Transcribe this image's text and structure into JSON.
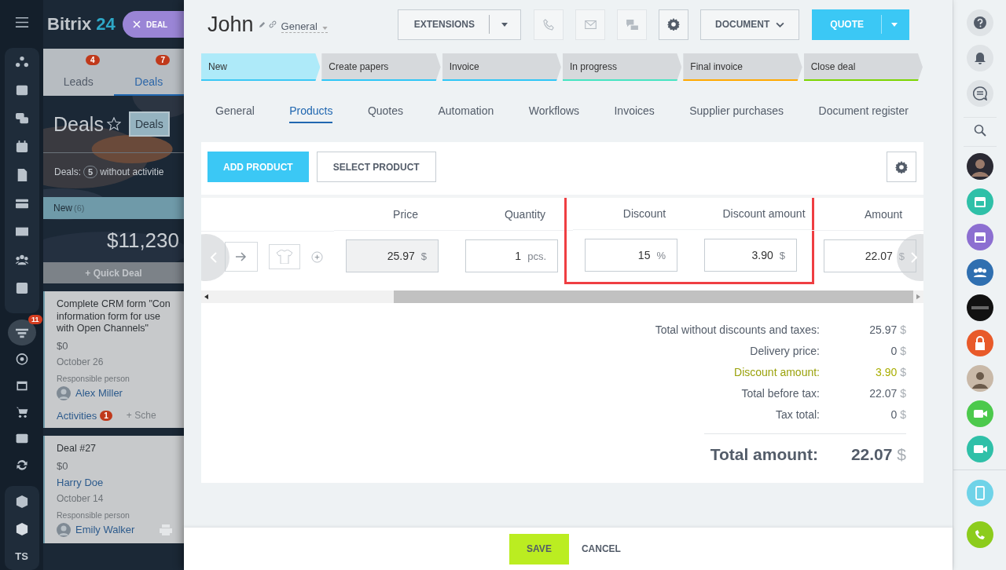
{
  "left_menu": {
    "funnel_badge": "11",
    "user_initials": "TS"
  },
  "crm": {
    "logo": "Bitrix",
    "logo_number": "24",
    "close_tab": "DEAL",
    "tabs": [
      {
        "label": "Leads",
        "badge": "4",
        "selected": false
      },
      {
        "label": "Deals",
        "badge": "7",
        "selected": true
      }
    ],
    "title": "Deals",
    "filter_button": "Deals",
    "counter_label": "Deals:",
    "counter": "5",
    "counter_text": "without activitie",
    "column": {
      "name": "New",
      "count": "(6)",
      "total": "$11,230",
      "quick_deal": "+ Quick Deal"
    },
    "cards": [
      {
        "title": "Complete CRM form \"Con\ninformation form for use\nwith Open Channels\"",
        "amount": "$0",
        "date": "October 26",
        "responsible_label": "Responsible person",
        "person": "Alex Miller",
        "activities": "Activities",
        "activities_badge": "1",
        "schedule": "+ Sche"
      },
      {
        "title": "Deal #27",
        "amount": "$0",
        "contact": "Harry Doe",
        "date": "October 14",
        "responsible_label": "Responsible person",
        "person": "Emily Walker"
      }
    ]
  },
  "deal": {
    "title": "John",
    "category": "General",
    "buttons": {
      "extensions": "EXTENSIONS",
      "document": "DOCUMENT",
      "quote": "QUOTE"
    },
    "stages": [
      {
        "label": "New",
        "color": "#3bc8f5",
        "selected": true
      },
      {
        "label": "Create papers",
        "color": "#2fc6f6",
        "selected": false
      },
      {
        "label": "Invoice",
        "color": "#2fc6f6",
        "selected": false
      },
      {
        "label": "In progress",
        "color": "#47e4c2",
        "selected": false
      },
      {
        "label": "Final invoice",
        "color": "#ffa900",
        "selected": false
      },
      {
        "label": "Close deal",
        "color": "#7bd500",
        "selected": false
      }
    ],
    "tabs": [
      {
        "label": "General",
        "selected": false
      },
      {
        "label": "Products",
        "selected": true
      },
      {
        "label": "Quotes",
        "selected": false
      },
      {
        "label": "Automation",
        "selected": false
      },
      {
        "label": "Workflows",
        "selected": false
      },
      {
        "label": "Invoices",
        "selected": false
      },
      {
        "label": "Supplier purchases",
        "selected": false
      },
      {
        "label": "Document register",
        "selected": false
      }
    ],
    "products": {
      "add_button": "ADD PRODUCT",
      "select_button": "SELECT PRODUCT",
      "columns": [
        {
          "header": "Price",
          "value": "25.97",
          "unit": "$",
          "disabled": true,
          "highlighted": false
        },
        {
          "header": "Quantity",
          "value": "1",
          "unit": "pcs.",
          "disabled": false,
          "highlighted": false
        },
        {
          "header": "Discount",
          "value": "15",
          "unit": "%",
          "disabled": false,
          "highlighted": true
        },
        {
          "header": "Discount amount",
          "value": "3.90",
          "unit": "$",
          "disabled": false,
          "highlighted": true
        },
        {
          "header": "Amount",
          "value": "22.07",
          "unit": "$",
          "disabled": false,
          "highlighted": false
        }
      ]
    },
    "totals": [
      {
        "label": "Total without discounts and taxes:",
        "value": "25.97",
        "currency": "$",
        "kind": "normal"
      },
      {
        "label": "Delivery price:",
        "value": "0",
        "currency": "$",
        "kind": "normal"
      },
      {
        "label": "Discount amount:",
        "value": "3.90",
        "currency": "$",
        "kind": "discount"
      },
      {
        "label": "Total before tax:",
        "value": "22.07",
        "currency": "$",
        "kind": "normal"
      },
      {
        "label": "Tax total:",
        "value": "0",
        "currency": "$",
        "kind": "normal"
      }
    ],
    "grand_total": {
      "label": "Total amount:",
      "value": "22.07",
      "currency": "$"
    },
    "footer": {
      "save": "SAVE",
      "cancel": "CANCEL"
    }
  }
}
